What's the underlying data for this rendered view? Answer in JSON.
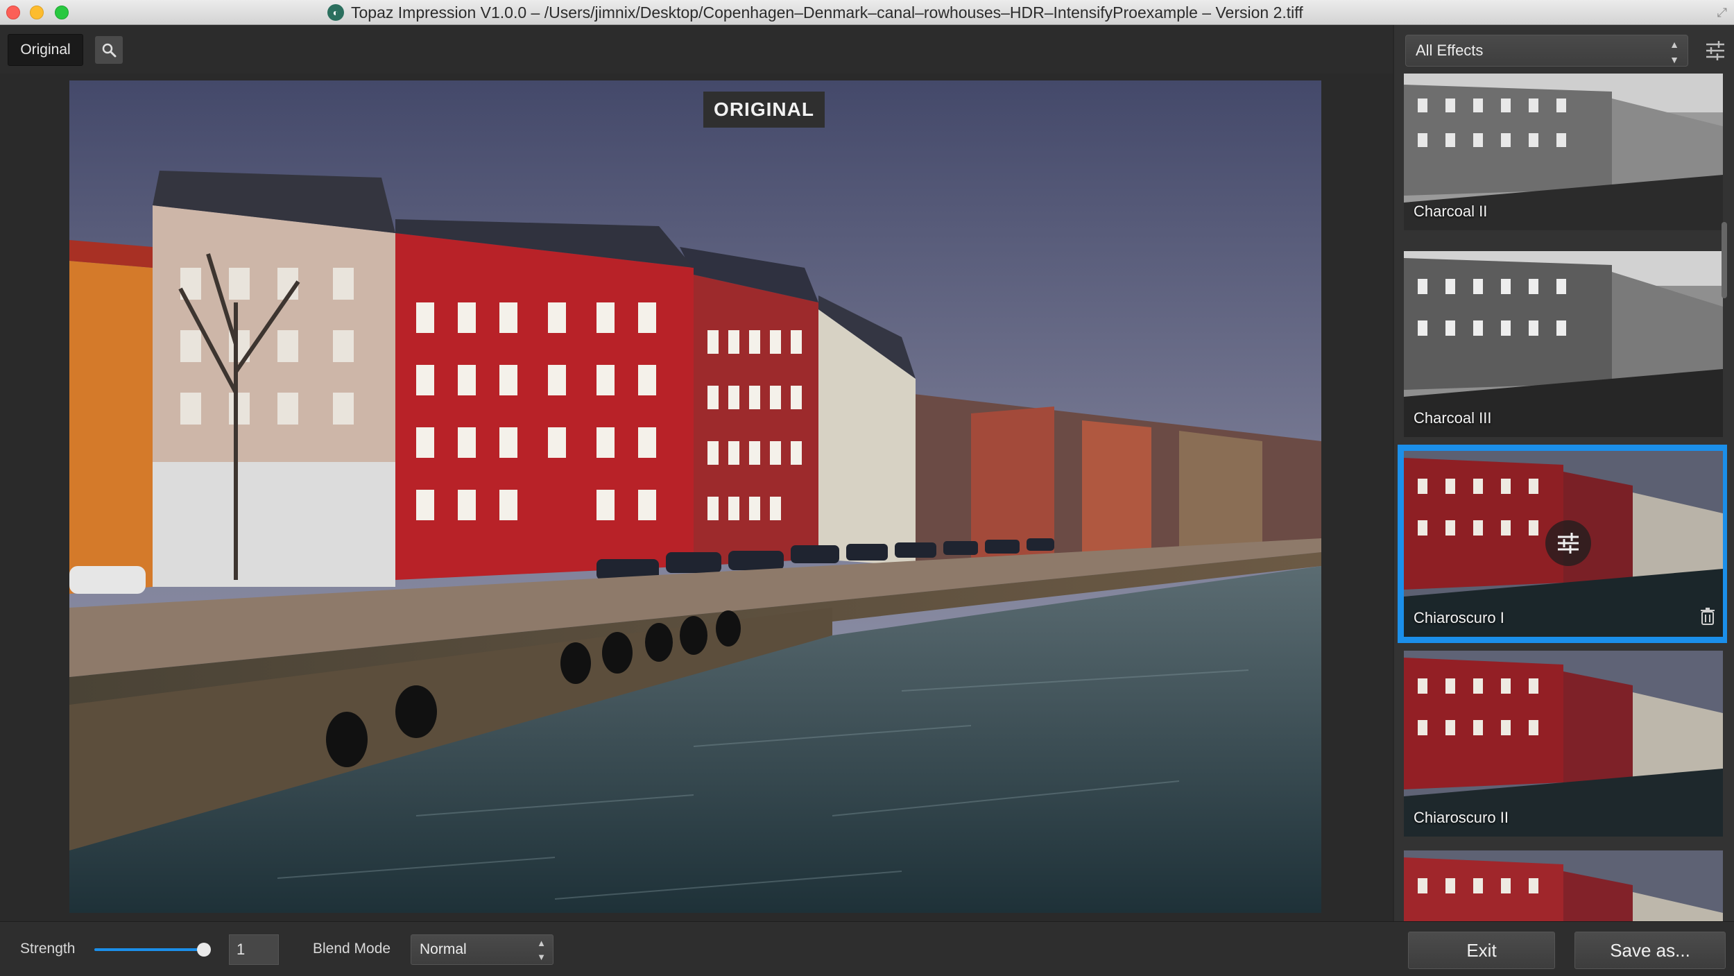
{
  "window": {
    "title": "Topaz Impression V1.0.0 – /Users/jimnix/Desktop/Copenhagen–Denmark–canal–rowhouses–HDR–IntensifyProexample – Version 2.tiff"
  },
  "toolbar": {
    "original_label": "Original",
    "zoom_icon": "magnifier-icon"
  },
  "canvas": {
    "badge": "ORIGINAL",
    "image_description_icon": "photo"
  },
  "side_panel": {
    "filter_value": "All Effects",
    "settings_icon": "sliders-icon",
    "thumbnails": [
      {
        "label": "Charcoal II",
        "style": "bw"
      },
      {
        "label": "Charcoal III",
        "style": "bw"
      },
      {
        "label": "Chiaroscuro I",
        "style": "color",
        "selected": true
      },
      {
        "label": "Chiaroscuro II",
        "style": "color"
      },
      {
        "label": "",
        "style": "color"
      }
    ],
    "selection_color": "#1b8fea"
  },
  "bottom": {
    "strength_label": "Strength",
    "strength_value": "1",
    "strength_fraction": 1.0,
    "blend_label": "Blend Mode",
    "blend_value": "Normal",
    "exit_label": "Exit",
    "save_label": "Save as..."
  }
}
